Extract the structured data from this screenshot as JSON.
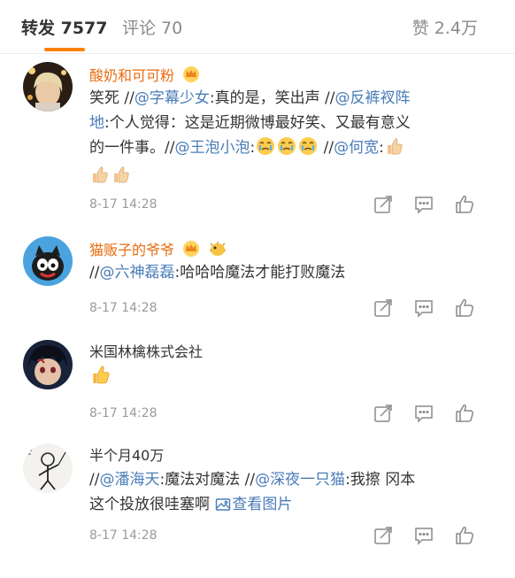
{
  "tabs": {
    "repost": "转发 7577",
    "comment": "评论 70",
    "like": "赞 2.4万"
  },
  "comments": [
    {
      "name": "酸奶和可可粉",
      "time": "8-17 14:28",
      "text": {
        "a": "笑死 //",
        "m1": "@字幕少女",
        "b": ":真的是，笑出声 //",
        "m2": "@反裤衩阵",
        "c": "地",
        "d": ":个人觉得：这是近期微博最好笑、又最有意义",
        "e": "的一件事。//",
        "m3": "@王泡小泡",
        "f": ":",
        "g": " //",
        "m4": "@何宽",
        "h": ":"
      }
    },
    {
      "name": "猫贩子的爷爷",
      "time": "8-17 14:28",
      "text": {
        "a": "//",
        "m1": "@六神磊磊",
        "b": ":哈哈哈魔法才能打败魔法"
      }
    },
    {
      "name": "米国林檎株式会社",
      "time": "8-17 14:28"
    },
    {
      "name": "半个月40万",
      "time": "8-17 14:28",
      "text": {
        "a": "//",
        "m1": "@潘海天",
        "b": ":魔法对魔法 //",
        "m2": "@深夜一只猫",
        "c": ":我擦 冈本",
        "d": "这个投放很哇塞啊 ",
        "link": "查看图片"
      }
    }
  ],
  "icons": {
    "badge": "crown-badge-icon",
    "badge2": "pufferfish-badge-icon",
    "emoji_cry": "cry-emoji-icon",
    "emoji_thumb": "thumbs-up-emoji-icon",
    "share": "share-icon",
    "comment": "comment-icon",
    "like": "like-icon",
    "picture": "picture-icon"
  },
  "colors": {
    "accent": "#ff8200",
    "vip_name": "#e86b0f",
    "mention": "#4a7cb8",
    "muted": "#9a9a9a"
  }
}
